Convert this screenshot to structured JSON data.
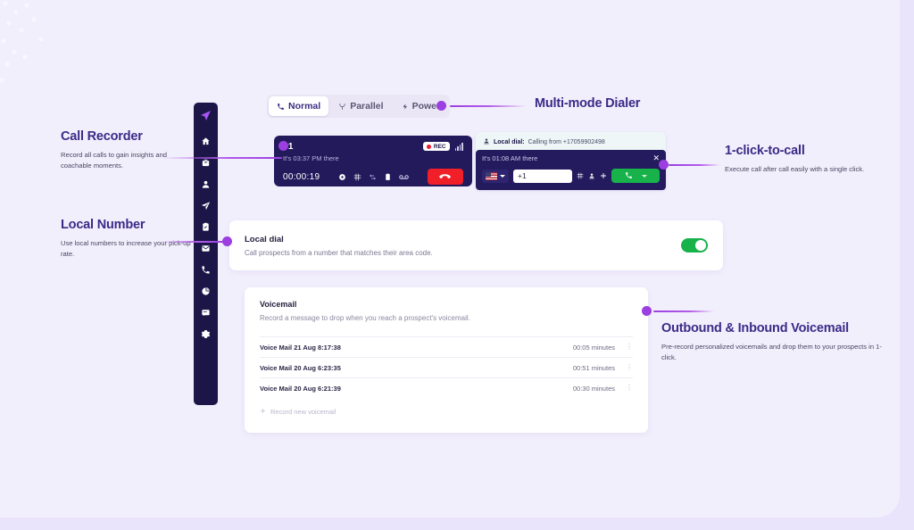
{
  "sidebar": {
    "logo_icon": "paper-plane-logo",
    "items": [
      {
        "icon": "home-icon",
        "name": "home"
      },
      {
        "icon": "inbox-icon",
        "name": "inbox"
      },
      {
        "icon": "person-icon",
        "name": "contacts"
      },
      {
        "icon": "send-icon",
        "name": "sequences"
      },
      {
        "icon": "clipboard-check-icon",
        "name": "tasks"
      },
      {
        "icon": "mail-icon",
        "name": "mail"
      },
      {
        "icon": "phone-icon",
        "name": "calls"
      },
      {
        "icon": "pie-chart-icon",
        "name": "analytics"
      },
      {
        "icon": "chat-icon",
        "name": "messages"
      },
      {
        "icon": "gear-icon",
        "name": "settings"
      }
    ]
  },
  "mode_tabs": {
    "items": [
      {
        "label": "Normal",
        "icon": "phone-icon",
        "active": true
      },
      {
        "label": "Parallel",
        "icon": "branch-icon",
        "active": false
      },
      {
        "label": "Power",
        "icon": "bolt-icon",
        "active": false
      }
    ]
  },
  "call_recorder": {
    "number": "+1",
    "local_time": "It's 03:37 PM there",
    "rec_badge": "REC",
    "timer": "00:00:19",
    "controls": [
      {
        "icon": "mute-circle-icon",
        "name": "mute"
      },
      {
        "icon": "keypad-icon",
        "name": "keypad"
      },
      {
        "icon": "transfer-icon",
        "name": "transfer"
      },
      {
        "icon": "notes-icon",
        "name": "notes"
      },
      {
        "icon": "voicemail-icon",
        "name": "voicemail-drop"
      }
    ],
    "hangup_icon": "hangup-phone-icon",
    "signal_icon": "signal-bars-icon"
  },
  "click_to_call": {
    "header_label": "Local dial:",
    "header_value": "Calling from +17059902498",
    "header_icon": "person-pin-icon",
    "local_time": "It's 01:08 AM there",
    "close_icon": "close-icon",
    "country_flag": "us-flag-icon",
    "phone_value": "+1",
    "phone_placeholder": "+1",
    "icons": [
      {
        "icon": "keypad-icon",
        "name": "keypad"
      },
      {
        "icon": "person-icon",
        "name": "contact"
      },
      {
        "icon": "plus-icon",
        "name": "add"
      }
    ],
    "call_icon": "phone-icon",
    "call_button_name": "call-button"
  },
  "local_dial": {
    "title": "Local dial",
    "subtitle": "Call prospects from a number that matches their area code.",
    "toggle_on": true,
    "accent_green": "#18b24b"
  },
  "voicemail": {
    "title": "Voicemail",
    "subtitle": "Record a message to drop when you reach a prospect's voicemail.",
    "rows": [
      {
        "name": "Voice Mail 21 Aug 8:17:38",
        "duration": "00:05 minutes"
      },
      {
        "name": "Voice Mail 20 Aug 6:23:35",
        "duration": "00:51 minutes"
      },
      {
        "name": "Voice Mail 20 Aug 6:21:39",
        "duration": "00:30 minutes"
      }
    ],
    "record_label": "Record new voicemail",
    "record_icon": "plus-icon"
  },
  "annotations": {
    "call_recorder": {
      "title": "Call Recorder",
      "desc": "Record all calls to gain insights and coachable moments."
    },
    "local_number": {
      "title": "Local Number",
      "desc": "Use local numbers to increase your pick-up rate."
    },
    "multi_mode": {
      "title": "Multi-mode Dialer",
      "desc": ""
    },
    "one_click": {
      "title": "1-click-to-call",
      "desc": "Execute call after call easily with a single click."
    },
    "voicemail": {
      "title": "Outbound & Inbound Voicemail",
      "desc": "Pre-record personalized voicemails and drop them to your prospects in 1-click."
    }
  },
  "colors": {
    "accent_purple": "#9b3fe0",
    "heading_purple": "#3b2a87",
    "dark_navy": "#1c1648",
    "widget_navy": "#231a5c",
    "red": "#f01f28",
    "green": "#18b24b",
    "background": "#e9e4fb",
    "panel": "#f2effd"
  }
}
